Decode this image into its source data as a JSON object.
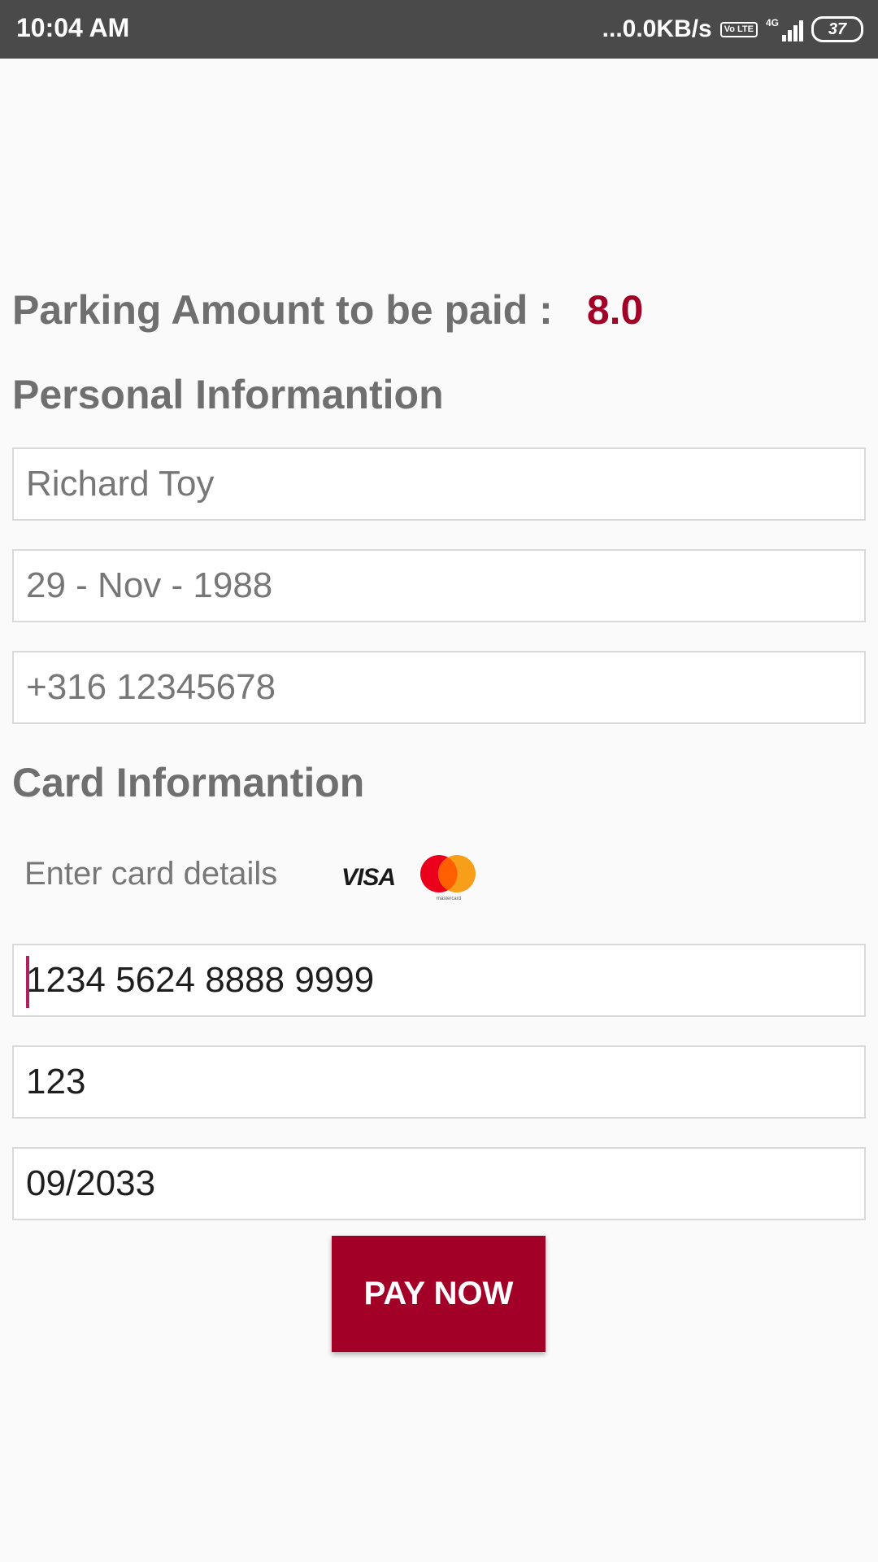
{
  "status_bar": {
    "time": "10:04 AM",
    "network_speed": "...0.0KB/s",
    "volte_label": "Vo LTE",
    "network_type": "4G",
    "battery": "37"
  },
  "payment": {
    "amount_label": "Parking Amount to be paid :",
    "amount_value": "8.0"
  },
  "personal_section": {
    "title": "Personal Informantion",
    "name": "Richard Toy",
    "dob": "29 - Nov - 1988",
    "phone": "+316 12345678"
  },
  "card_section": {
    "title": "Card Informantion",
    "hint": "Enter card details",
    "visa_label": "VISA",
    "mastercard_label": "mastercard",
    "card_number": "1234 5624 8888 9999",
    "cvv": "123",
    "expiry": "09/2033"
  },
  "actions": {
    "pay_label": "PAY NOW"
  },
  "colors": {
    "accent": "#a30028",
    "status_bar": "#4a4a4a",
    "heading_text": "#6f6f6f"
  }
}
